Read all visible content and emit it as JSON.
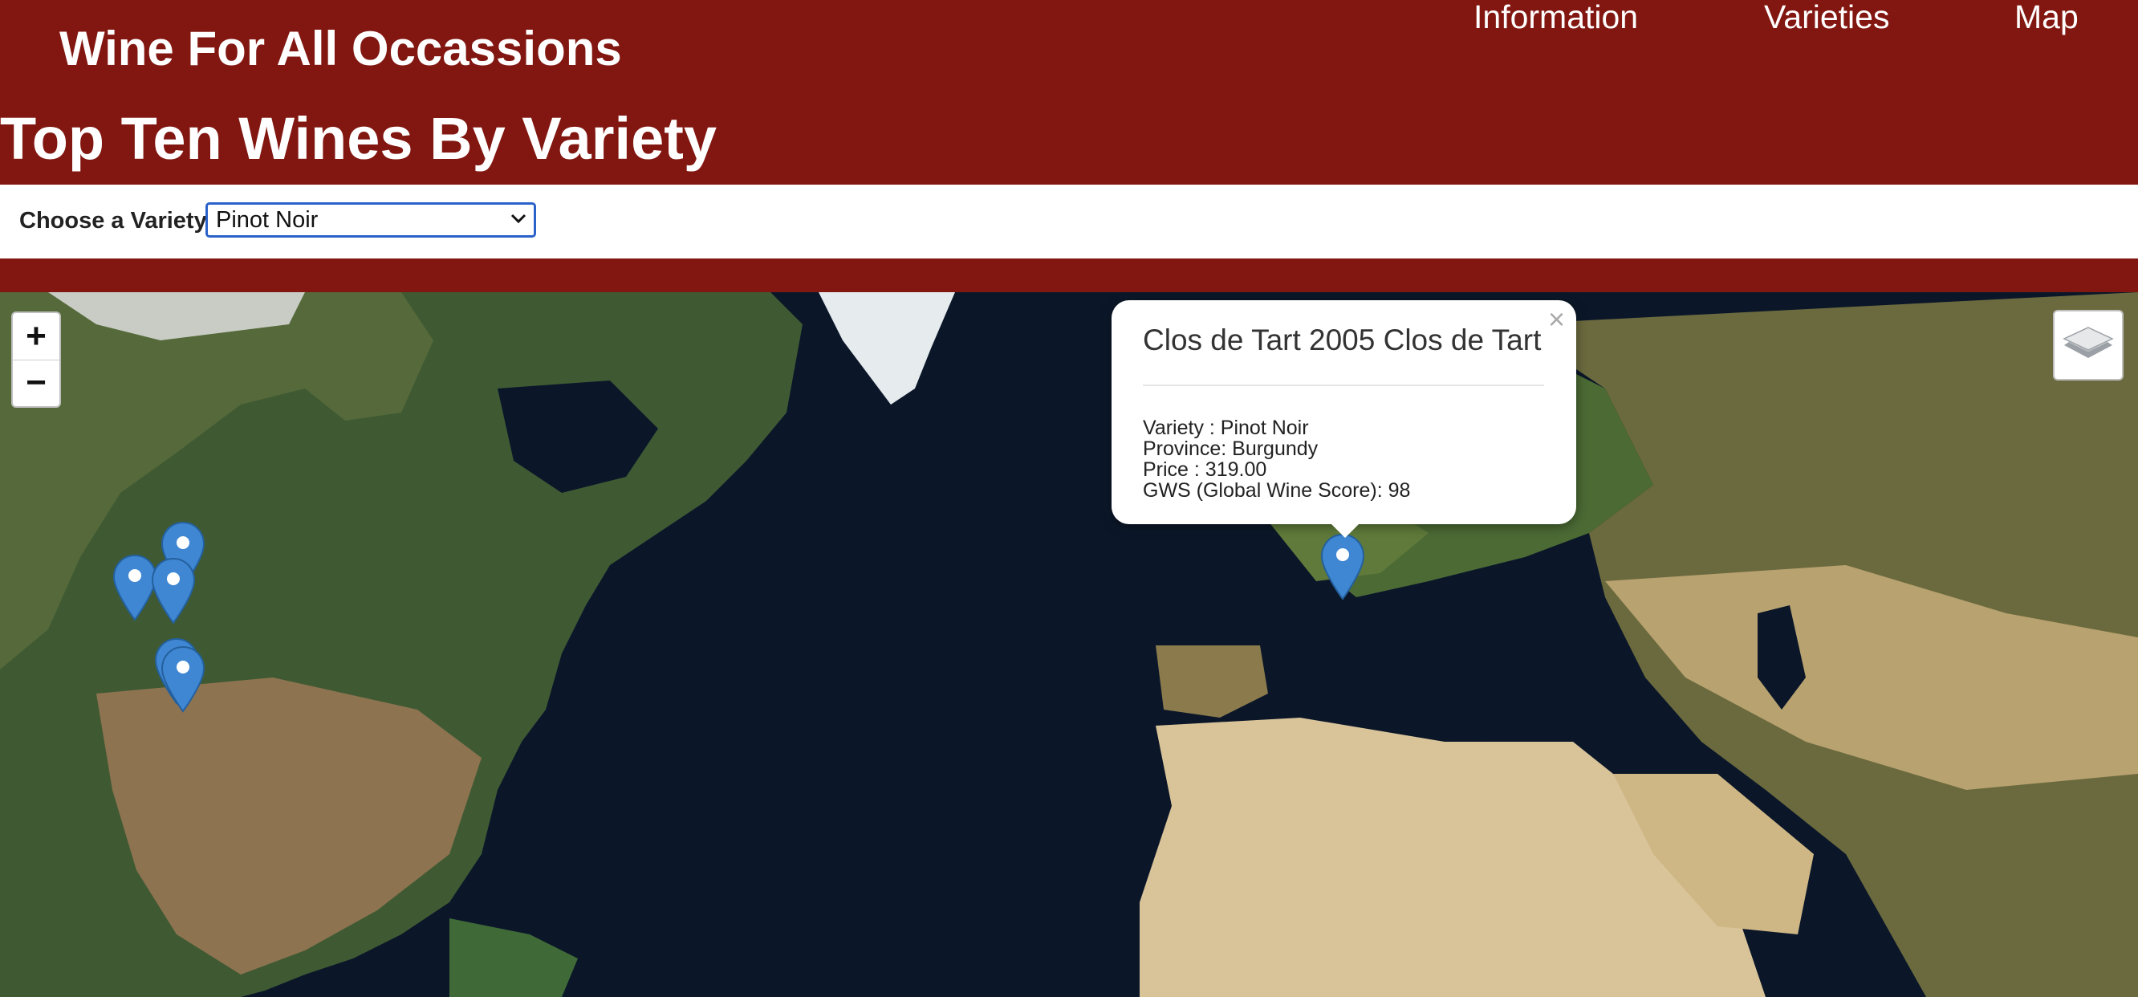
{
  "header": {
    "brand": "Wine For All Occassions",
    "nav": [
      "Information",
      "Varieties",
      "Map"
    ],
    "page_title": "Top Ten Wines By Variety"
  },
  "filter": {
    "label": "Choose a Variety",
    "selected": "Pinot Noir"
  },
  "map": {
    "zoom_in": "+",
    "zoom_out": "−",
    "layers_icon": "layers-icon",
    "marker_color": "#3f87d2",
    "popup": {
      "close": "×",
      "title": "Clos de Tart 2005 Clos de Tart",
      "lines": [
        "Variety : Pinot Noir",
        "Province: Burgundy",
        "Price : 319.00",
        "GWS (Global Wine Score): 98"
      ]
    }
  },
  "colors": {
    "brand": "#821711",
    "select_border": "#2a62c9"
  }
}
